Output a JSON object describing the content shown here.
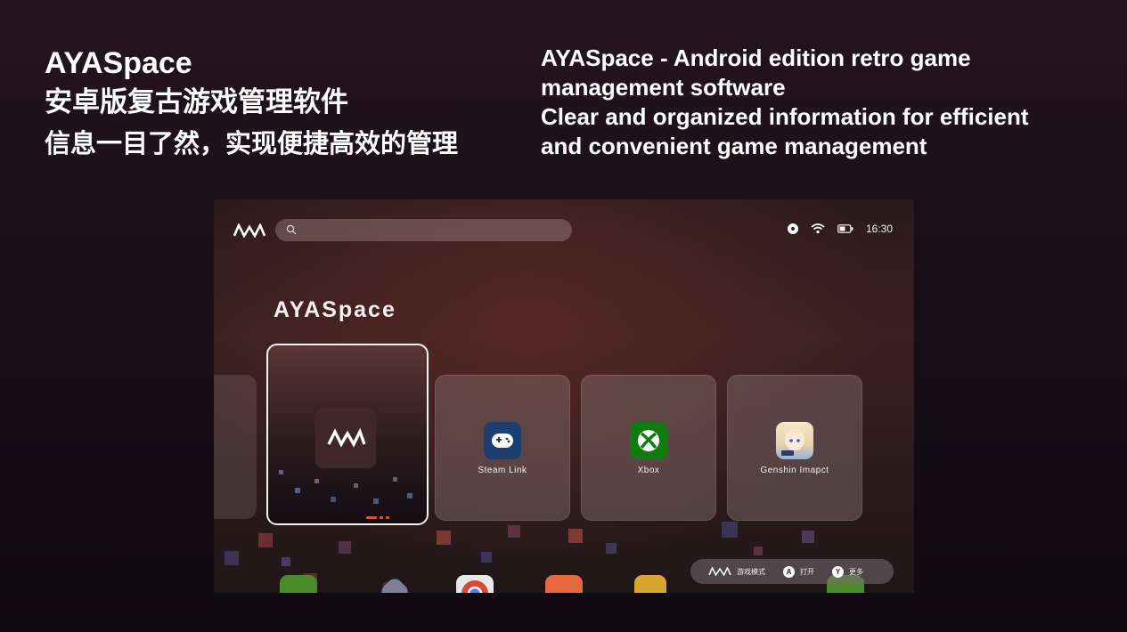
{
  "headline_left": {
    "title": "AYASpace",
    "subtitle": "安卓版复古游戏管理软件",
    "tagline": "信息一目了然，实现便捷高效的管理"
  },
  "headline_right": {
    "line1": "AYASpace - Android edition retro game",
    "line2": "management software",
    "line3": "Clear and organized information for efficient",
    "line4": "and convenient game management"
  },
  "screen": {
    "status": {
      "time": "16:30"
    },
    "search": {
      "placeholder": ""
    },
    "section_title": "AYASpace",
    "cards": [
      {
        "label": "Steam Link",
        "icon": "steam-link-icon"
      },
      {
        "label": "Xbox",
        "icon": "xbox-icon"
      },
      {
        "label": "Genshin Imapct",
        "icon": "genshin-impact-icon"
      }
    ],
    "hint_bar": {
      "mode_label": "游戏模式",
      "a_button": "A",
      "a_label": "打开",
      "y_button": "Y",
      "y_label": "更多"
    }
  },
  "colors": {
    "xbox_green": "#107c10",
    "steam_blue": "#1b3f73",
    "accent_red": "#e24b3c"
  }
}
